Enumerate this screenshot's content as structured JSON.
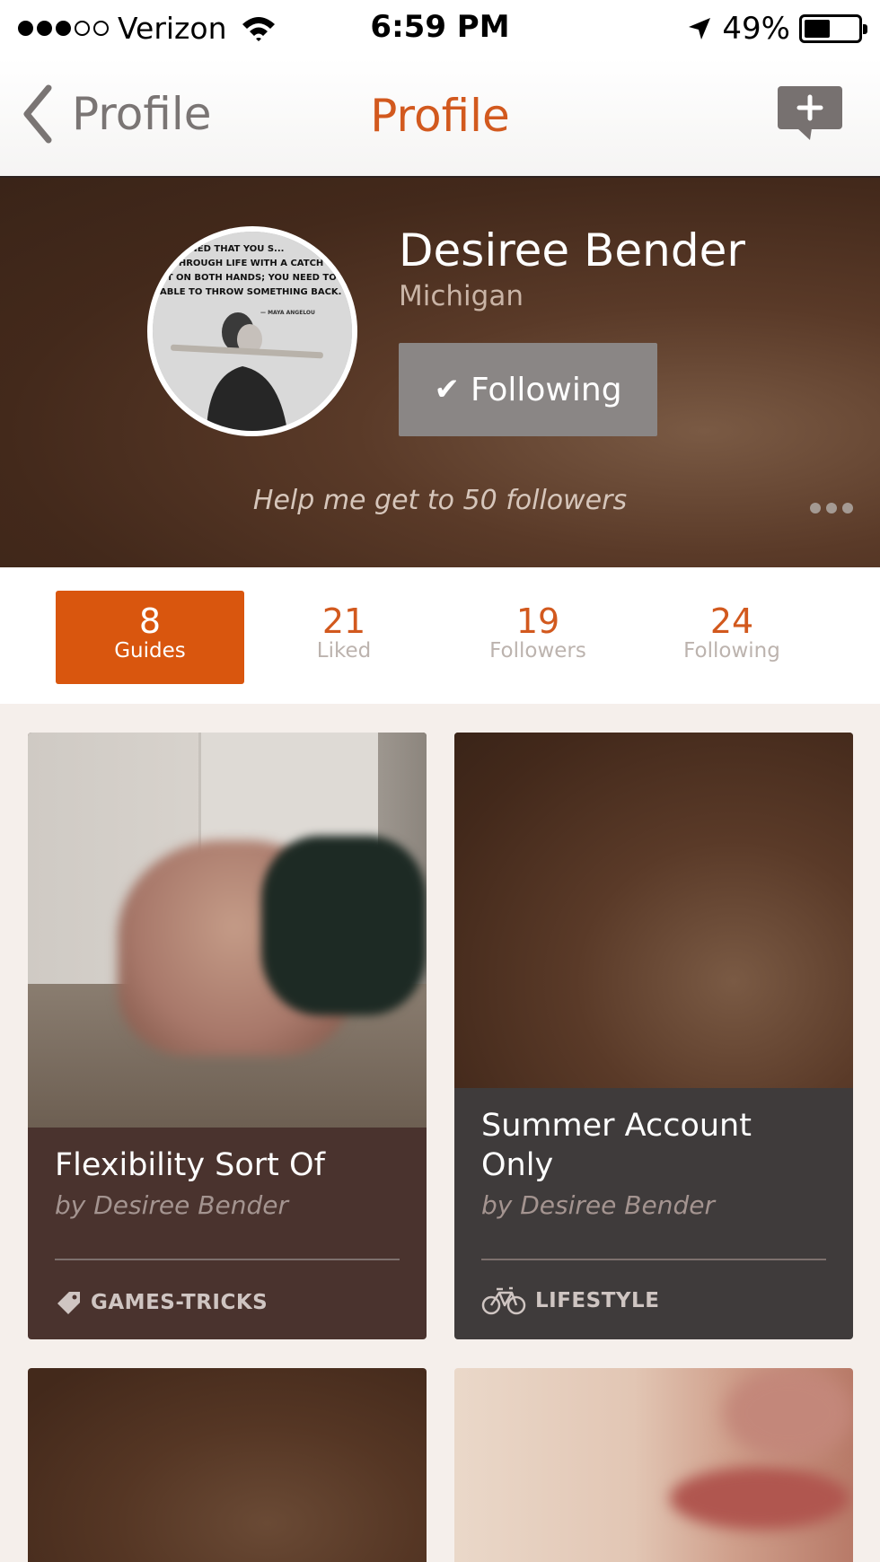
{
  "status_bar": {
    "carrier": "Verizon",
    "time": "6:59 PM",
    "battery_percent": "49%",
    "battery_level": 0.49,
    "icons": [
      "signal-dots",
      "wifi-icon",
      "location-arrow-icon",
      "battery-icon"
    ]
  },
  "nav": {
    "back_label": "Profile",
    "title": "Profile",
    "compose_icon": "compose-message-icon"
  },
  "profile": {
    "name": "Desiree Bender",
    "location": "Michigan",
    "following_button": "Following",
    "tagline": "Help me get to 50 followers",
    "avatar_quote": "...NED THAT YOU S... THROUGH LIFE WITH A CATCH... IT ON BOTH HANDS; YOU NEED TO... ABLE TO THROW SOMETHING BACK.",
    "avatar_credit": "— MAYA ANGELOU"
  },
  "stats": [
    {
      "value": "8",
      "label": "Guides",
      "active": true
    },
    {
      "value": "21",
      "label": "Liked",
      "active": false
    },
    {
      "value": "19",
      "label": "Followers",
      "active": false
    },
    {
      "value": "24",
      "label": "Following",
      "active": false
    }
  ],
  "guides": [
    {
      "title": "Flexibility Sort Of",
      "author": "by Desiree Bender",
      "category": "GAMES-TRICKS",
      "category_icon": "tag-icon",
      "card_color": "#4a332e"
    },
    {
      "title": "Summer Account Only",
      "author": "by Desiree Bender",
      "category": "LIFESTYLE",
      "category_icon": "bicycle-icon",
      "card_color": "#3f3b3b"
    }
  ],
  "colors": {
    "accent": "#d2591e",
    "active_tab": "#d9560e",
    "following_button": "#8a8685"
  }
}
